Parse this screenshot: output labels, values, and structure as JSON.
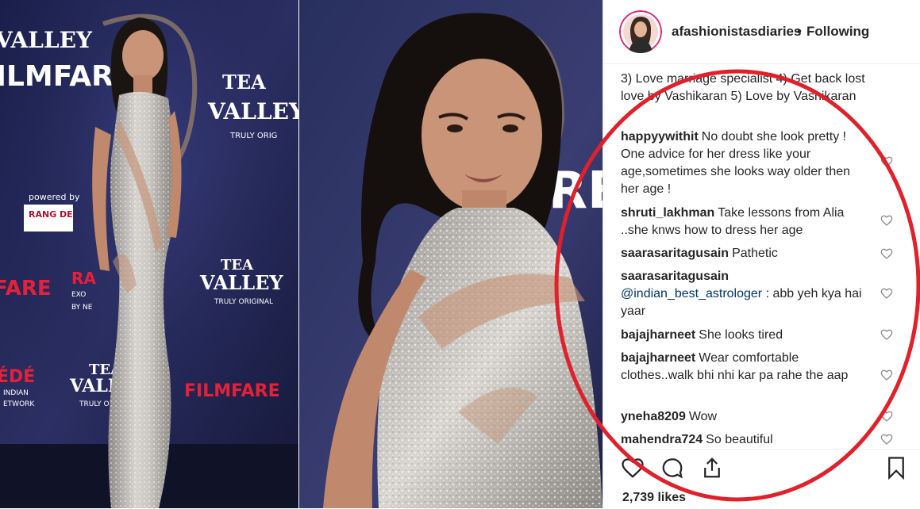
{
  "left_photo": {
    "backdrop_texts": [
      "VALLEY",
      "FILMFARE",
      "TEA",
      "VALLEY",
      "TRULY ORIG",
      "powered by",
      "RANG DE",
      "FARE",
      "RA",
      "EXO",
      "BY NE",
      "TEA",
      "VALLEY",
      "TRULY ORIGINAL",
      "ÉDÉ",
      "INDIAN",
      "ETWORK",
      "TEA",
      "VALLEY",
      "TRULY ORIGINAL",
      "FILMFARE"
    ]
  },
  "right_photo": {
    "backdrop_texts": [
      "FRE"
    ]
  },
  "post": {
    "username": "afashionistasdiaries",
    "separator": "•",
    "follow_status": "Following"
  },
  "comments": [
    {
      "user": "",
      "text": "3) Love marriage specialist 4) Get back lost love by Vashikaran 5) Love by Vashikaran"
    },
    {
      "user": "happyywithit",
      "text": "No doubt she look pretty ! One advice for her dress like your age,sometimes she looks way older then her age !"
    },
    {
      "user": "shruti_lakhman",
      "text": "Take lessons from Alia ..she knws how to dress her age"
    },
    {
      "user": "saarasaritagusain",
      "text": "Pathetic"
    },
    {
      "user": "saarasaritagusain",
      "mention": "@indian_best_astrologer",
      "text": ": abb yeh kya hai yaar"
    },
    {
      "user": "bajajharneet",
      "text": "She looks tired"
    },
    {
      "user": "bajajharneet",
      "text": "Wear comfortable clothes..walk bhi nhi kar pa rahe the aap"
    },
    {
      "user": "yneha8209",
      "text": "Wow"
    },
    {
      "user": "mahendra724",
      "text": "So beautiful"
    }
  ],
  "likes": "2,739 likes",
  "icons": [
    "heart-icon",
    "comment-icon",
    "share-icon",
    "bookmark-icon"
  ],
  "colors": {
    "annotation": "#e0202a",
    "text": "#262626",
    "link": "#003569"
  }
}
